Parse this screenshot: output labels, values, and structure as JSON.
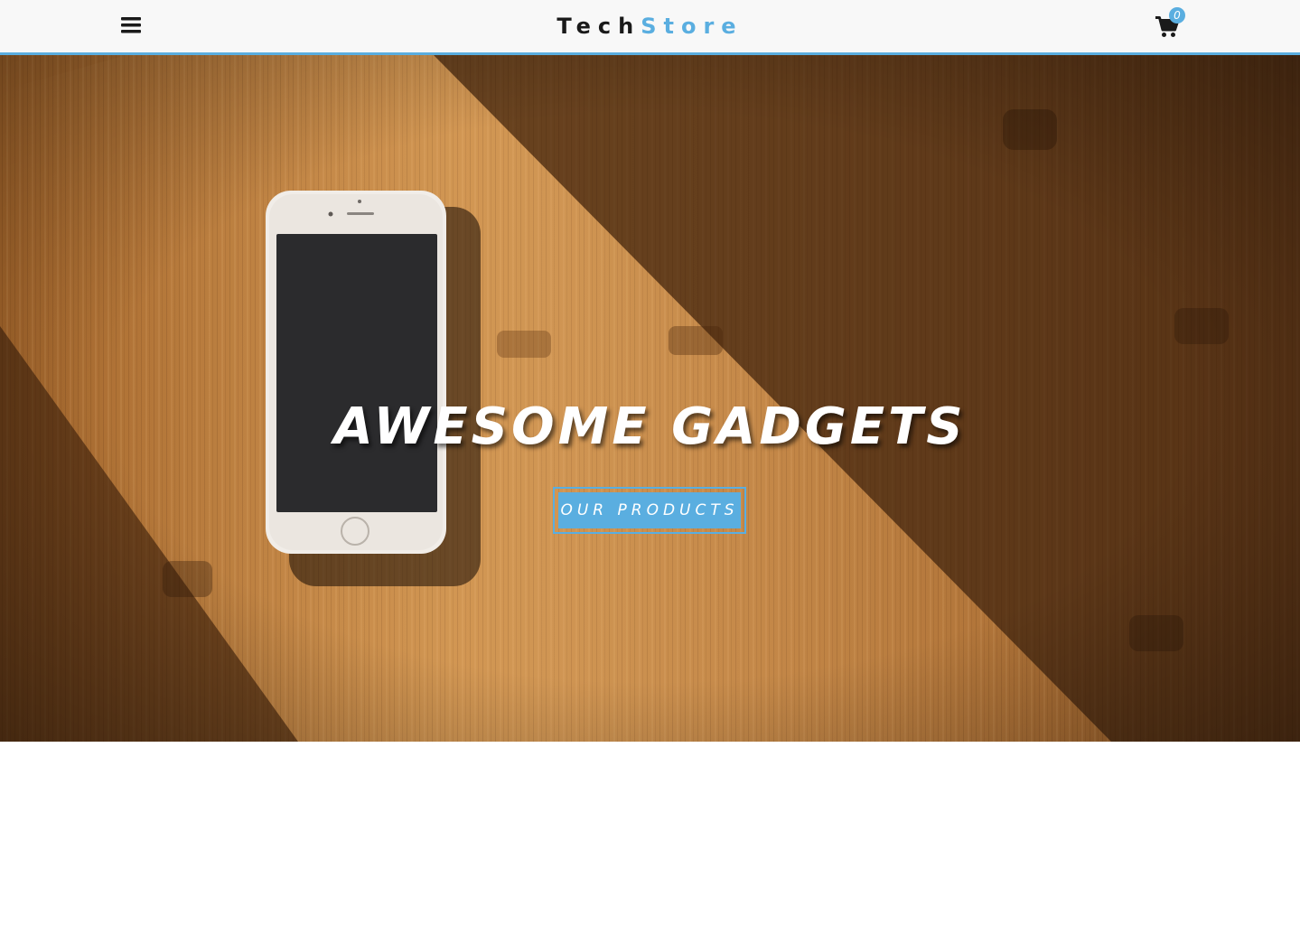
{
  "navbar": {
    "menu_icon": "hamburger-menu-icon",
    "brand_part_a": "Tech",
    "brand_part_b": "Store",
    "cart_icon": "shopping-cart-icon",
    "cart_count": "0"
  },
  "hero": {
    "background": "smartphone-on-wooden-table-photo",
    "title": "AWESOME GADGETS",
    "cta_label": "OUR PRODUCTS"
  },
  "colors": {
    "accent": "#5aaee0",
    "brand_dark": "#1a1a1a",
    "navbar_bg": "#f8f8f8"
  }
}
